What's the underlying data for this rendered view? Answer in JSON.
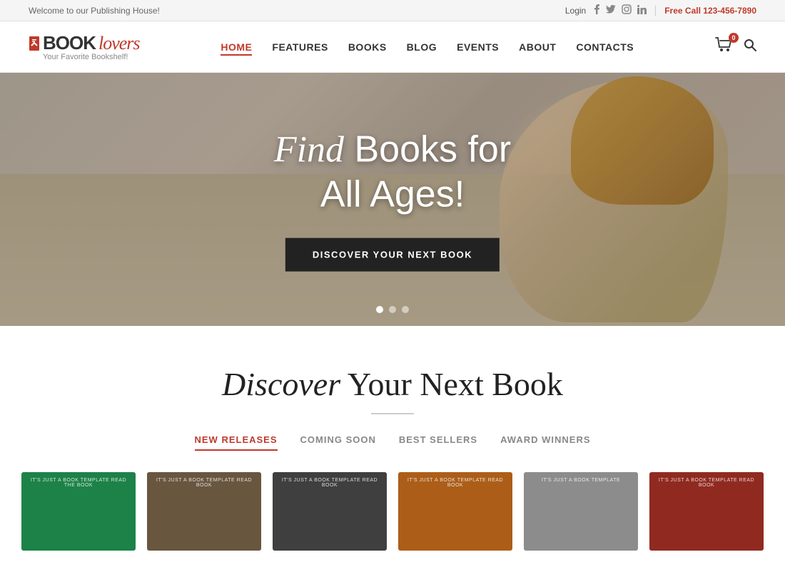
{
  "topbar": {
    "welcome": "Welcome to our Publishing House!",
    "login": "Login",
    "social": {
      "facebook": "f",
      "twitter": "t",
      "instagram": "i",
      "linkedin": "in"
    },
    "free_call_label": "Free Call",
    "phone": "123-456-7890"
  },
  "header": {
    "logo": {
      "book": "BOOK",
      "lovers": "lovers",
      "tagline": "Your Favorite Bookshelf!"
    },
    "nav": [
      {
        "label": "HOME",
        "active": true
      },
      {
        "label": "FEATURES",
        "active": false
      },
      {
        "label": "BOOKS",
        "active": false
      },
      {
        "label": "BLOG",
        "active": false
      },
      {
        "label": "EVENTS",
        "active": false
      },
      {
        "label": "ABOUT",
        "active": false
      },
      {
        "label": "CONTACTS",
        "active": false
      }
    ],
    "cart_count": "0"
  },
  "hero": {
    "title_italic": "Find",
    "title_rest": " Books for\nAll Ages!",
    "cta_button": "DISCOVER YOUR NEXT BOOK",
    "dots": [
      {
        "active": true
      },
      {
        "active": false
      },
      {
        "active": false
      }
    ]
  },
  "discover_section": {
    "title_italic": "Discover",
    "title_rest": " Your Next Book",
    "tabs": [
      {
        "label": "NEW RELEASES",
        "active": true
      },
      {
        "label": "COMING SOON",
        "active": false
      },
      {
        "label": "BEST SELLERS",
        "active": false
      },
      {
        "label": "AWARD WINNERS",
        "active": false
      }
    ],
    "books": [
      {
        "id": 1,
        "color": "green",
        "label": "IT'S JUST A BOOK TEMPLATE   READ THE BOOK",
        "read": ""
      },
      {
        "id": 2,
        "color": "brown",
        "label": "IT'S JUST A BOOK TEMPLATE   READ BOOK",
        "read": ""
      },
      {
        "id": 3,
        "color": "dark",
        "label": "IT'S JUST A BOOK TEMPLATE   READ BOOK",
        "read": ""
      },
      {
        "id": 4,
        "color": "orange",
        "label": "IT'S JUST A BOOK TEMPLATE   READ BOOK",
        "read": ""
      },
      {
        "id": 5,
        "color": "gray",
        "label": "IT'S JUST A BOOK TEMPLATE",
        "read": ""
      },
      {
        "id": 6,
        "color": "red",
        "label": "IT'S JUST A BOOK TEMPLATE   READ BOOK",
        "read": ""
      }
    ]
  }
}
